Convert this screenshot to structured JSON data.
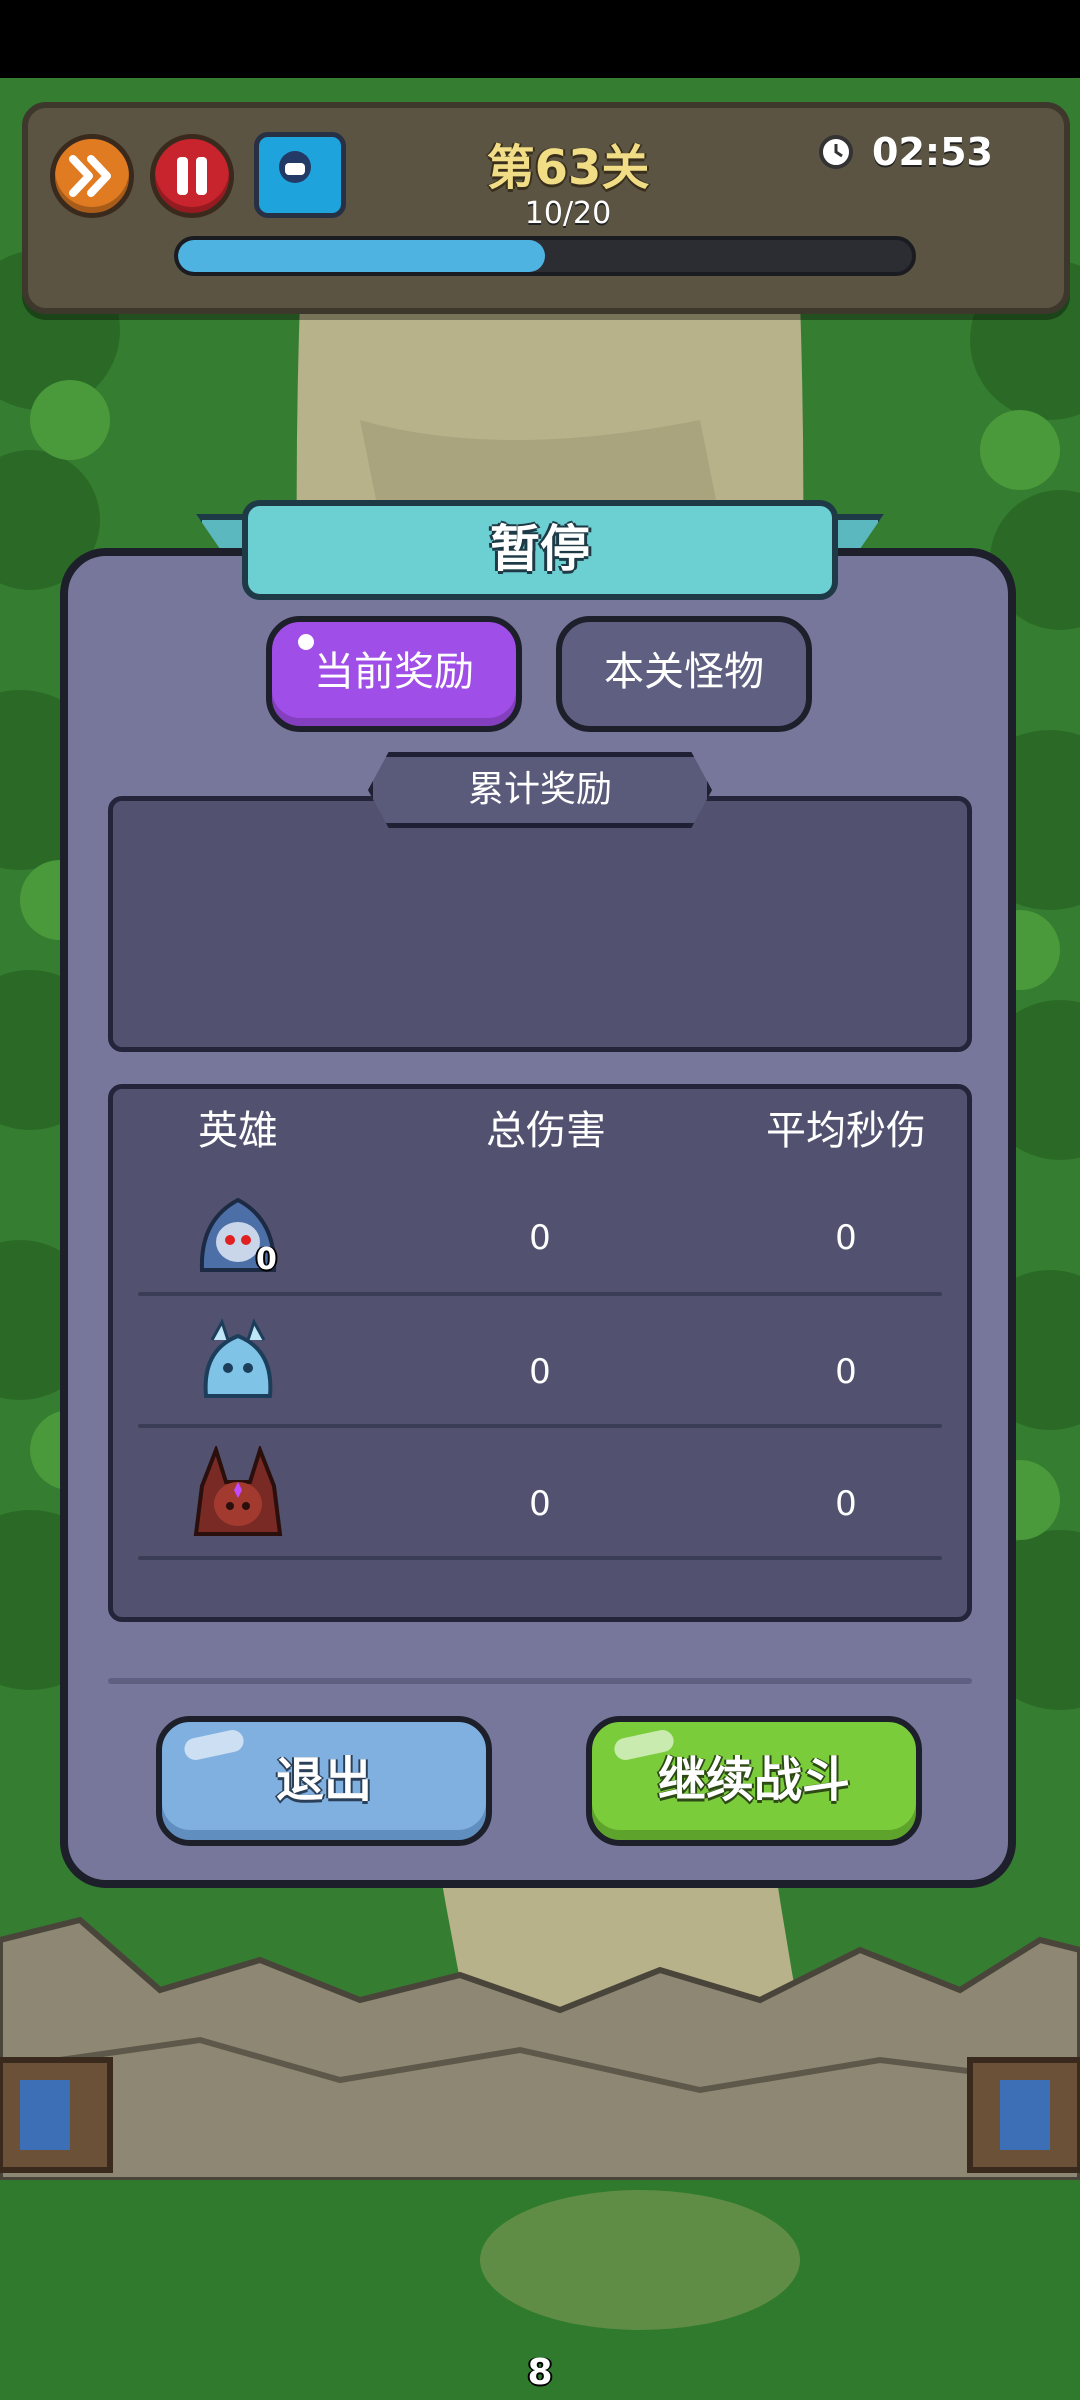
{
  "hud": {
    "level_title": "第63关",
    "wave_progress_text": "10/20",
    "wave_progress_fraction": 0.5,
    "timer": "02:53"
  },
  "dialog": {
    "title": "暂停",
    "tabs": [
      {
        "label": "当前奖励",
        "active": true
      },
      {
        "label": "本关怪物",
        "active": false
      }
    ],
    "reward_section_label": "累计奖励",
    "table": {
      "headers": [
        "英雄",
        "总伤害",
        "平均秒伤"
      ],
      "rows": [
        {
          "hero_icon": "blue-hooded-hero-icon",
          "badge": "0",
          "total_damage": "0",
          "avg_dps": "0"
        },
        {
          "hero_icon": "ice-dragon-hero-icon",
          "total_damage": "0",
          "avg_dps": "0"
        },
        {
          "hero_icon": "dark-dragon-hero-icon",
          "total_damage": "0",
          "avg_dps": "0"
        }
      ]
    },
    "buttons": {
      "exit": "退出",
      "continue": "继续战斗"
    }
  },
  "footer": {
    "counter": "8"
  },
  "colors": {
    "panel": "#77779c",
    "tab_active": "#a04ee8",
    "exit_button": "#7fb0e0",
    "continue_button": "#7bcc3a",
    "progress_fill": "#4fb3e2",
    "title_banner": "#6ccfd2"
  }
}
